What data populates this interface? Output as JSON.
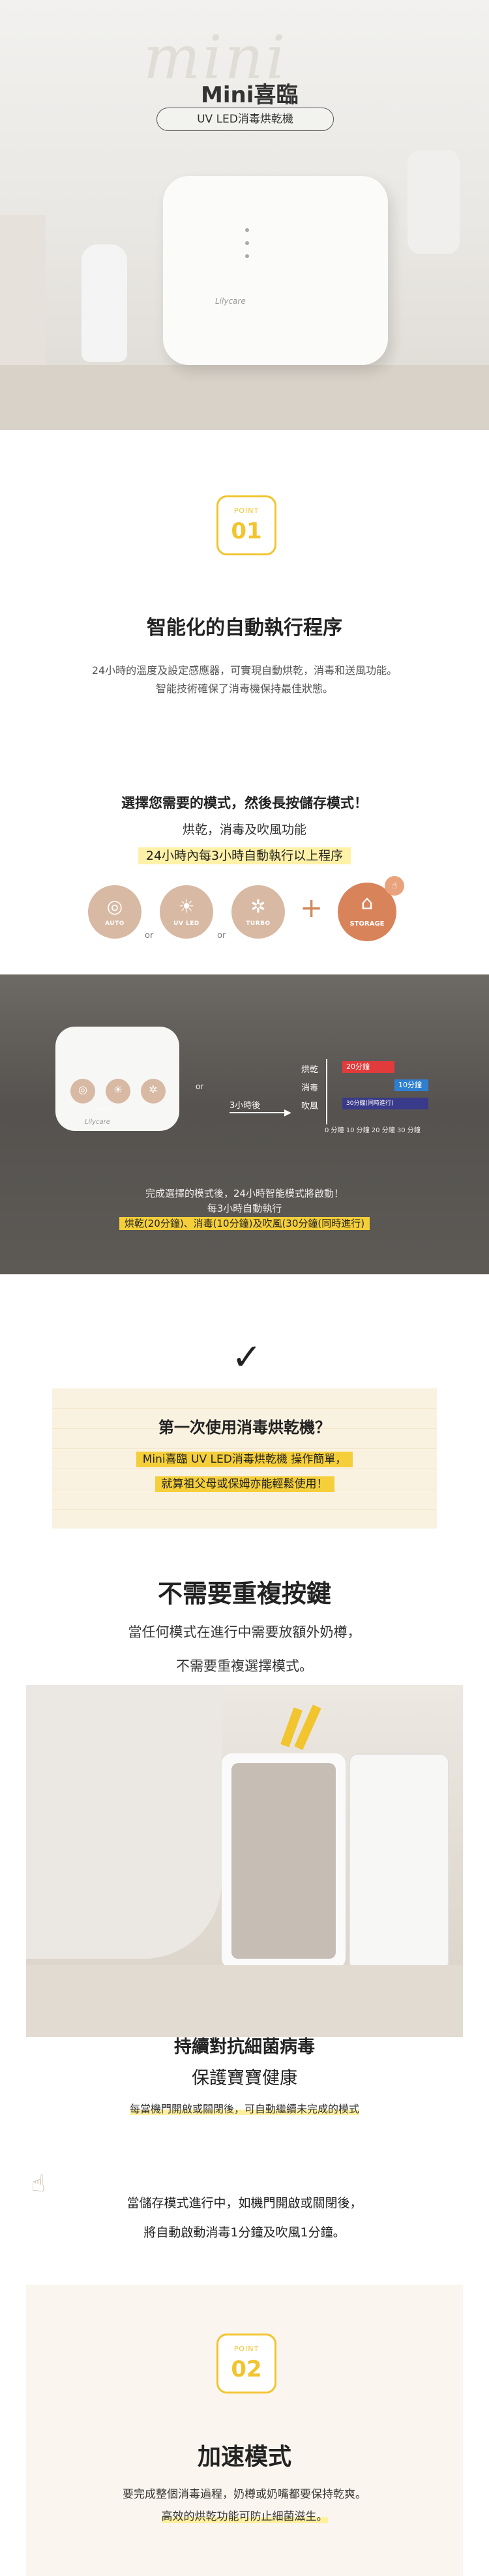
{
  "hero": {
    "script_word": "mini",
    "title": "Mini喜臨",
    "subtitle": "UV LED消毒烘乾機",
    "device_logo": "Lilycare"
  },
  "point1": {
    "label": "POINT",
    "number": "01",
    "heading": "智能化的自動執行程序",
    "body_line1": "24小時的溫度及設定感應器，可實現自動烘乾，消毒和送風功能。",
    "body_line2": "智能技術確保了消毒機保持最佳狀態。"
  },
  "mode_section": {
    "line1": "選擇您需要的模式，然後長按儲存模式！",
    "line2": "烘乾，消毒及吹風功能",
    "line3": "24小時內每3小時自動執行以上程序",
    "modes": [
      {
        "icon": "auto-icon",
        "label": "AUTO"
      },
      {
        "icon": "uv-led-icon",
        "label": "UV LED"
      },
      {
        "icon": "turbo-icon",
        "label": "TURBO"
      }
    ],
    "or_label": "or",
    "plus": "+",
    "storage_label": "STORAGE"
  },
  "timeline": {
    "device_modes": [
      "AUTO",
      "UV LED",
      "TURBO"
    ],
    "device_logo": "Lilycare",
    "or_label": "or",
    "after_label": "3小時後",
    "rows": [
      {
        "name": "烘乾",
        "bar_label": "20分鐘",
        "color": "#e23b3b"
      },
      {
        "name": "消毒",
        "bar_label": "10分鐘",
        "color": "#2f7fd1"
      },
      {
        "name": "吹風",
        "bar_label": "30分鐘(同時進行)",
        "color": "#3a3a8a"
      }
    ],
    "axis": "0 分鐘 10 分鐘 20 分鐘 30 分鐘",
    "note1": "完成選擇的模式後，24小時智能模式將啟動！",
    "note2": "每3小時自動執行",
    "note3": "烘乾(20分鐘)、消毒(10分鐘)及吹風(30分鐘(同時進行)"
  },
  "first_use": {
    "check": "✓",
    "heading": "第一次使用消毒烘乾機？",
    "line1": "Mini喜臨 UV LED消毒烘乾機 操作簡單，",
    "line2": "就算祖父母或保姆亦能輕鬆使用！"
  },
  "no_repeat": {
    "heading": "不需要重複按鍵",
    "line1": "當任何模式在進行中需要放額外奶樽，",
    "line2": "不需要重複選擇模式。"
  },
  "antibac": {
    "heading": "持續對抗細菌病毒",
    "subheading": "保護寶寶健康",
    "body": "每當機門開啟或關閉後，可自動繼續未完成的模式",
    "note_line1": "當儲存模式進行中，如機門開啟或關閉後，",
    "note_line2": "將自動啟動消毒1分鐘及吹風1分鐘。"
  },
  "point2": {
    "label": "POINT",
    "number": "02",
    "heading": "加速模式",
    "line1": "要完成整個消毒過程，奶樽或奶嘴都要保持乾爽。",
    "line2": "高效的烘乾功能可防止細菌滋生。"
  },
  "colors": {
    "accent_yellow": "#f2c42d",
    "mode_circle": "#d8b9a3",
    "storage": "#d9835b",
    "highlight": "#fff2a8"
  }
}
